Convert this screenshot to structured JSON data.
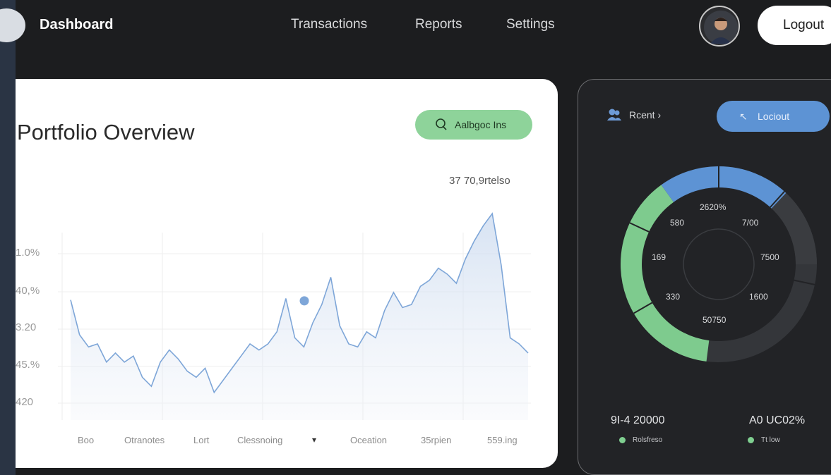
{
  "header": {
    "brand": "Dashboard",
    "nav": [
      "Transactions",
      "Reports",
      "Settings"
    ],
    "logout_label": "Logout"
  },
  "portfolio": {
    "title": "Portfolio Overview",
    "action_label": "Aalbgoc Ins",
    "note": "37 70,9rtelso"
  },
  "chart_data": {
    "type": "area",
    "title": "",
    "xlabel": "",
    "ylabel": "",
    "y_tick_labels": [
      "1.0%",
      "40,%",
      "3.20",
      "45.%",
      "420"
    ],
    "x_tick_labels": [
      "Boo",
      "Otranotes",
      "Lort",
      "Clessnoing",
      "Oceation",
      "35rpien",
      "559.ing"
    ],
    "grid": true,
    "series": [
      {
        "values": [
          69,
          46,
          38,
          40,
          28,
          34,
          28,
          32,
          18,
          12,
          28,
          36,
          30,
          22,
          18,
          24,
          8,
          16,
          24,
          32,
          40,
          36,
          40,
          48,
          70,
          44,
          38,
          54,
          66,
          84,
          52,
          40,
          38,
          48,
          44,
          62,
          74,
          64,
          66,
          78,
          82,
          90,
          86,
          80,
          96,
          108,
          118,
          126,
          92,
          44,
          40,
          34
        ]
      }
    ],
    "highlight_point_value": 54
  },
  "side_panel": {
    "header": "Rcent ›",
    "logout_label": "Lociout",
    "donut": {
      "slices": [
        {
          "value": 38,
          "color": "#7ecb8e"
        },
        {
          "value": 22,
          "color": "#5d93d4"
        },
        {
          "value": 40,
          "color": "#3a3c40"
        }
      ],
      "labels": [
        "2620%",
        "580",
        "7/00",
        "169",
        "7500",
        "330",
        "1600",
        "50750"
      ]
    },
    "stats": [
      {
        "value": "9I-4 20000",
        "legend": "Rolsfreso"
      },
      {
        "value": "A0 UC02%",
        "legend": "Tt low"
      }
    ]
  },
  "colors": {
    "background": "#1c1d1f",
    "chart_line": "#7ea6d8",
    "accent_green": "#8ed39a",
    "accent_blue": "#5d93d4"
  }
}
